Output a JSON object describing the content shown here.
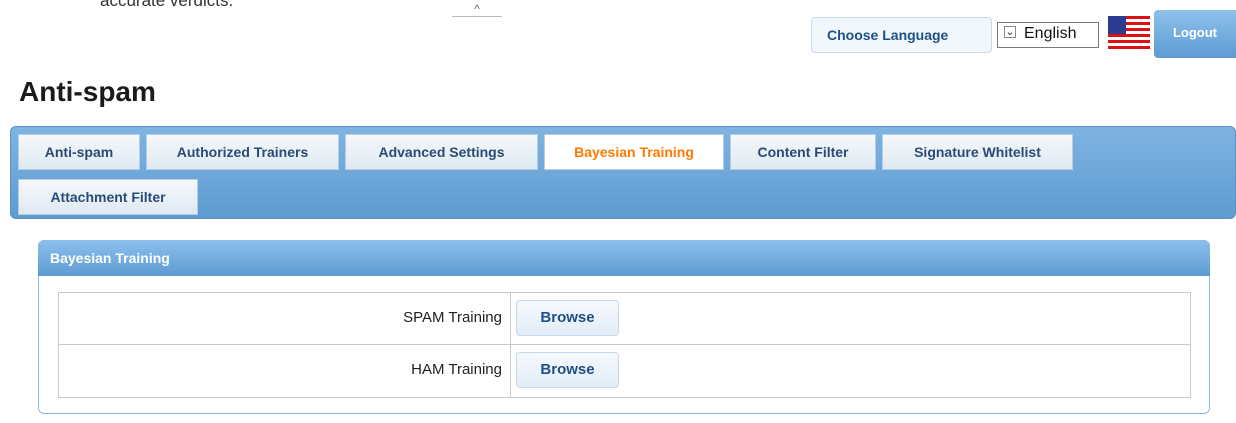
{
  "caption": "accurate verdicts.",
  "header": {
    "collapse_glyph": "^",
    "language_label": "Choose Language",
    "language_selected": "English",
    "logout_label": "Logout",
    "flag_icon": "us-flag-icon"
  },
  "page_title": "Anti-spam",
  "tabs": [
    {
      "label": "Anti-spam",
      "active": false
    },
    {
      "label": "Authorized Trainers",
      "active": false
    },
    {
      "label": "Advanced Settings",
      "active": false
    },
    {
      "label": "Bayesian Training",
      "active": true
    },
    {
      "label": "Content Filter",
      "active": false
    },
    {
      "label": "Signature Whitelist",
      "active": false
    },
    {
      "label": "Attachment Filter",
      "active": false
    }
  ],
  "section": {
    "title": "Bayesian Training",
    "rows": [
      {
        "label": "SPAM Training",
        "button": "Browse"
      },
      {
        "label": "HAM Training",
        "button": "Browse"
      }
    ]
  },
  "colors": {
    "accent_blue": "#5e9bd0",
    "active_tab_text": "#ff7a00",
    "link_text": "#1f4f86"
  }
}
